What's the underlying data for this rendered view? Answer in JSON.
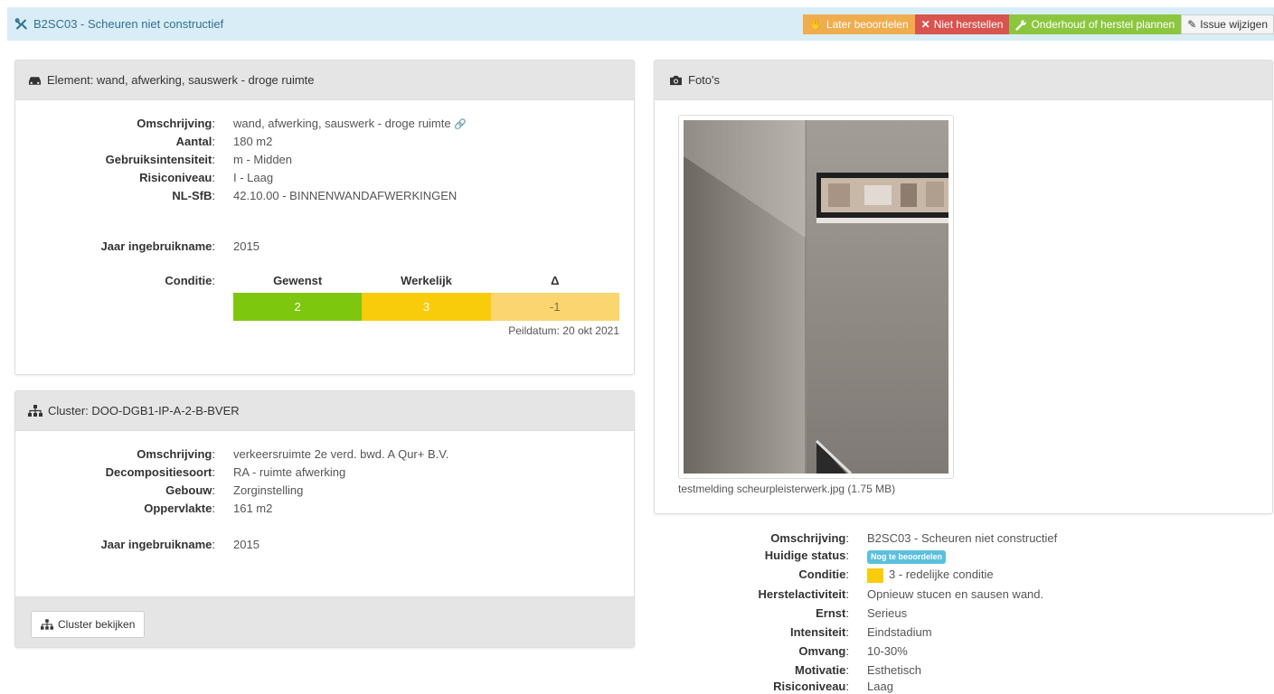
{
  "header": {
    "title": "B2SC03 - Scheuren niet constructief",
    "actions": {
      "later": "Later beoordelen",
      "niet": "Niet herstellen",
      "onderhoud": "Onderhoud of herstel plannen",
      "wijzigen": "Issue wijzigen"
    }
  },
  "element": {
    "heading": "Element: wand, afwerking, sauswerk - droge ruimte",
    "fields": [
      {
        "label": "Omschrijving",
        "value": "wand, afwerking, sauswerk - droge ruimte"
      },
      {
        "label": "Aantal",
        "value": "180 m2"
      },
      {
        "label": "Gebruiksintensiteit",
        "value": "m - Midden"
      },
      {
        "label": "Risiconiveau",
        "value": "I - Laag"
      },
      {
        "label": "NL-SfB",
        "value": "42.10.00 - BINNENWANDAFWERKINGEN"
      }
    ],
    "jaar_label": "Jaar ingebruikname",
    "jaar_value": "2015",
    "conditie_label": "Conditie",
    "conditie": {
      "headers": [
        "Gewenst",
        "Werkelijk",
        "Δ"
      ],
      "values": [
        "2",
        "3",
        "-1"
      ],
      "colors": [
        "#7dc70f",
        "#f9cc0b",
        "#fad570"
      ],
      "peildatum": "Peildatum: 20 okt 2021"
    }
  },
  "cluster": {
    "heading": "Cluster: DOO-DGB1-IP-A-2-B-BVER",
    "fields": [
      {
        "label": "Omschrijving",
        "value": "verkeersruimte 2e verd. bwd. A Qur+ B.V."
      },
      {
        "label": "Decompositiesoort",
        "value": "RA - ruimte afwerking"
      },
      {
        "label": "Gebouw",
        "value": "Zorginstelling"
      },
      {
        "label": "Oppervlakte",
        "value": "161 m2"
      }
    ],
    "jaar_label": "Jaar ingebruikname",
    "jaar_value": "2015",
    "button": "Cluster bekijken"
  },
  "photos": {
    "heading": "Foto's",
    "caption": "testmelding scheurpleisterwerk.jpg (1.75 MB)"
  },
  "issue": {
    "fields": [
      {
        "label": "Omschrijving",
        "value": "B2SC03 - Scheuren niet constructief"
      },
      {
        "label": "Huidige status",
        "value": "Nog te beoordelen"
      },
      {
        "label": "Conditie",
        "value": "3 - redelijke conditie"
      },
      {
        "label": "Herstelactiviteit",
        "value": "Opnieuw stucen en sausen wand."
      },
      {
        "label": "Ernst",
        "value": "Serieus"
      },
      {
        "label": "Intensiteit",
        "value": "Eindstadium"
      },
      {
        "label": "Omvang",
        "value": "10-30%"
      },
      {
        "label": "Motivatie",
        "value": "Esthetisch"
      },
      {
        "label": "Risiconiveau",
        "value": "Laag"
      }
    ],
    "conditie_color": "#f9cc0b",
    "status_color": "#5bc0de"
  }
}
